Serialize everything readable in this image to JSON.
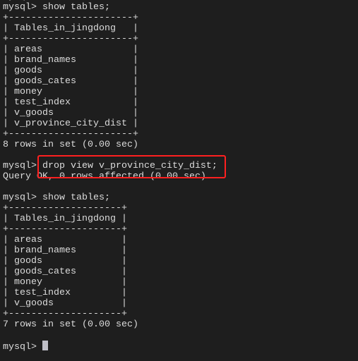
{
  "terminal": {
    "lines": [
      "mysql>",
      "mysql> show tables;",
      "+----------------------+",
      "| Tables_in_jingdong   |",
      "+----------------------+",
      "| areas                |",
      "| brand_names          |",
      "| goods                |",
      "| goods_cates          |",
      "| money                |",
      "| test_index           |",
      "| v_goods              |",
      "| v_province_city_dist |",
      "+----------------------+",
      "8 rows in set (0.00 sec)",
      "",
      "mysql> drop view v_province_city_dist;",
      "Query OK, 0 rows affected (0.00 sec)",
      "",
      "mysql> show tables;",
      "+--------------------+",
      "| Tables_in_jingdong |",
      "+--------------------+",
      "| areas              |",
      "| brand_names        |",
      "| goods              |",
      "| goods_cates        |",
      "| money              |",
      "| test_index         |",
      "| v_goods            |",
      "+--------------------+",
      "7 rows in set (0.00 sec)",
      ""
    ],
    "prompt": "mysql> ",
    "highlight_color": "#ff2020"
  }
}
